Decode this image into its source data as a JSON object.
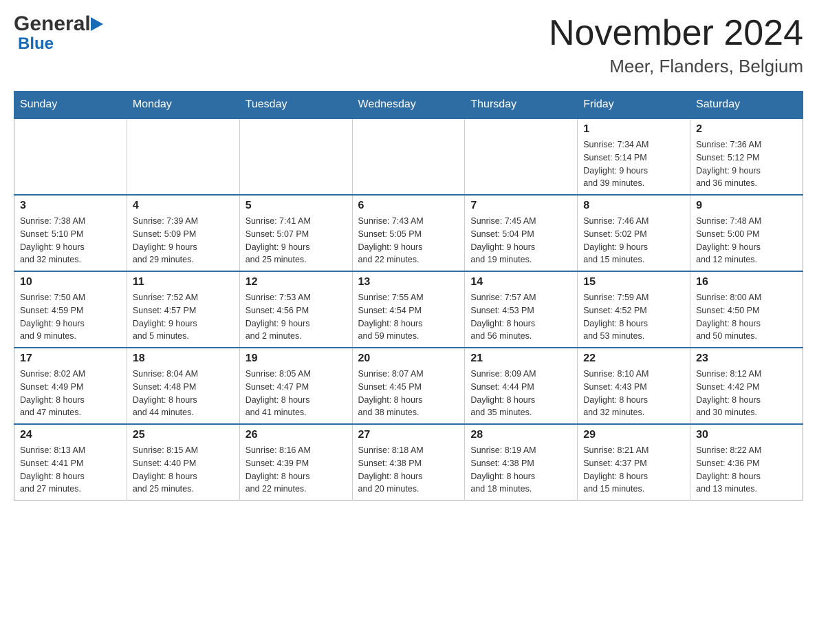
{
  "header": {
    "logo_general": "General",
    "logo_blue": "Blue",
    "month_title": "November 2024",
    "location": "Meer, Flanders, Belgium"
  },
  "calendar": {
    "days_of_week": [
      "Sunday",
      "Monday",
      "Tuesday",
      "Wednesday",
      "Thursday",
      "Friday",
      "Saturday"
    ],
    "weeks": [
      {
        "days": [
          {
            "number": "",
            "info": "",
            "empty": true
          },
          {
            "number": "",
            "info": "",
            "empty": true
          },
          {
            "number": "",
            "info": "",
            "empty": true
          },
          {
            "number": "",
            "info": "",
            "empty": true
          },
          {
            "number": "",
            "info": "",
            "empty": true
          },
          {
            "number": "1",
            "info": "Sunrise: 7:34 AM\nSunset: 5:14 PM\nDaylight: 9 hours\nand 39 minutes."
          },
          {
            "number": "2",
            "info": "Sunrise: 7:36 AM\nSunset: 5:12 PM\nDaylight: 9 hours\nand 36 minutes."
          }
        ]
      },
      {
        "days": [
          {
            "number": "3",
            "info": "Sunrise: 7:38 AM\nSunset: 5:10 PM\nDaylight: 9 hours\nand 32 minutes."
          },
          {
            "number": "4",
            "info": "Sunrise: 7:39 AM\nSunset: 5:09 PM\nDaylight: 9 hours\nand 29 minutes."
          },
          {
            "number": "5",
            "info": "Sunrise: 7:41 AM\nSunset: 5:07 PM\nDaylight: 9 hours\nand 25 minutes."
          },
          {
            "number": "6",
            "info": "Sunrise: 7:43 AM\nSunset: 5:05 PM\nDaylight: 9 hours\nand 22 minutes."
          },
          {
            "number": "7",
            "info": "Sunrise: 7:45 AM\nSunset: 5:04 PM\nDaylight: 9 hours\nand 19 minutes."
          },
          {
            "number": "8",
            "info": "Sunrise: 7:46 AM\nSunset: 5:02 PM\nDaylight: 9 hours\nand 15 minutes."
          },
          {
            "number": "9",
            "info": "Sunrise: 7:48 AM\nSunset: 5:00 PM\nDaylight: 9 hours\nand 12 minutes."
          }
        ]
      },
      {
        "days": [
          {
            "number": "10",
            "info": "Sunrise: 7:50 AM\nSunset: 4:59 PM\nDaylight: 9 hours\nand 9 minutes."
          },
          {
            "number": "11",
            "info": "Sunrise: 7:52 AM\nSunset: 4:57 PM\nDaylight: 9 hours\nand 5 minutes."
          },
          {
            "number": "12",
            "info": "Sunrise: 7:53 AM\nSunset: 4:56 PM\nDaylight: 9 hours\nand 2 minutes."
          },
          {
            "number": "13",
            "info": "Sunrise: 7:55 AM\nSunset: 4:54 PM\nDaylight: 8 hours\nand 59 minutes."
          },
          {
            "number": "14",
            "info": "Sunrise: 7:57 AM\nSunset: 4:53 PM\nDaylight: 8 hours\nand 56 minutes."
          },
          {
            "number": "15",
            "info": "Sunrise: 7:59 AM\nSunset: 4:52 PM\nDaylight: 8 hours\nand 53 minutes."
          },
          {
            "number": "16",
            "info": "Sunrise: 8:00 AM\nSunset: 4:50 PM\nDaylight: 8 hours\nand 50 minutes."
          }
        ]
      },
      {
        "days": [
          {
            "number": "17",
            "info": "Sunrise: 8:02 AM\nSunset: 4:49 PM\nDaylight: 8 hours\nand 47 minutes."
          },
          {
            "number": "18",
            "info": "Sunrise: 8:04 AM\nSunset: 4:48 PM\nDaylight: 8 hours\nand 44 minutes."
          },
          {
            "number": "19",
            "info": "Sunrise: 8:05 AM\nSunset: 4:47 PM\nDaylight: 8 hours\nand 41 minutes."
          },
          {
            "number": "20",
            "info": "Sunrise: 8:07 AM\nSunset: 4:45 PM\nDaylight: 8 hours\nand 38 minutes."
          },
          {
            "number": "21",
            "info": "Sunrise: 8:09 AM\nSunset: 4:44 PM\nDaylight: 8 hours\nand 35 minutes."
          },
          {
            "number": "22",
            "info": "Sunrise: 8:10 AM\nSunset: 4:43 PM\nDaylight: 8 hours\nand 32 minutes."
          },
          {
            "number": "23",
            "info": "Sunrise: 8:12 AM\nSunset: 4:42 PM\nDaylight: 8 hours\nand 30 minutes."
          }
        ]
      },
      {
        "days": [
          {
            "number": "24",
            "info": "Sunrise: 8:13 AM\nSunset: 4:41 PM\nDaylight: 8 hours\nand 27 minutes."
          },
          {
            "number": "25",
            "info": "Sunrise: 8:15 AM\nSunset: 4:40 PM\nDaylight: 8 hours\nand 25 minutes."
          },
          {
            "number": "26",
            "info": "Sunrise: 8:16 AM\nSunset: 4:39 PM\nDaylight: 8 hours\nand 22 minutes."
          },
          {
            "number": "27",
            "info": "Sunrise: 8:18 AM\nSunset: 4:38 PM\nDaylight: 8 hours\nand 20 minutes."
          },
          {
            "number": "28",
            "info": "Sunrise: 8:19 AM\nSunset: 4:38 PM\nDaylight: 8 hours\nand 18 minutes."
          },
          {
            "number": "29",
            "info": "Sunrise: 8:21 AM\nSunset: 4:37 PM\nDaylight: 8 hours\nand 15 minutes."
          },
          {
            "number": "30",
            "info": "Sunrise: 8:22 AM\nSunset: 4:36 PM\nDaylight: 8 hours\nand 13 minutes."
          }
        ]
      }
    ]
  }
}
